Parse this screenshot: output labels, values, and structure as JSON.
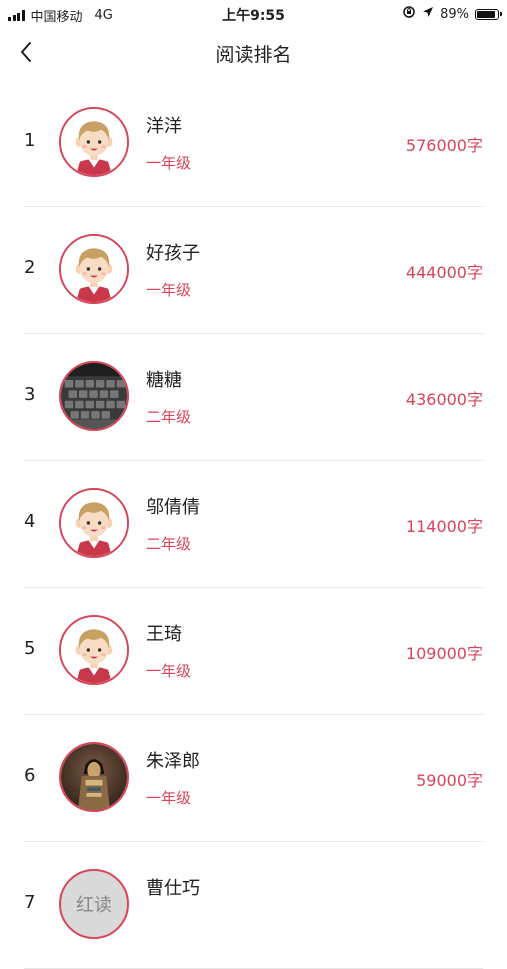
{
  "status_bar": {
    "carrier": "中国移动",
    "network": "4G",
    "time": "上午9:55",
    "battery": "89%",
    "battery_level": 0.89
  },
  "nav": {
    "title": "阅读排名",
    "back_icon": "chevron-left-icon"
  },
  "ranking": [
    {
      "rank": "1",
      "name": "洋洋",
      "grade": "一年级",
      "words": "576000字",
      "avatar": "cartoon-boy"
    },
    {
      "rank": "2",
      "name": "好孩子",
      "grade": "一年级",
      "words": "444000字",
      "avatar": "cartoon-boy"
    },
    {
      "rank": "3",
      "name": "糖糖",
      "grade": "二年级",
      "words": "436000字",
      "avatar": "keyboard-photo"
    },
    {
      "rank": "4",
      "name": "邬倩倩",
      "grade": "二年级",
      "words": "114000字",
      "avatar": "cartoon-boy"
    },
    {
      "rank": "5",
      "name": "王琦",
      "grade": "一年级",
      "words": "109000字",
      "avatar": "cartoon-boy"
    },
    {
      "rank": "6",
      "name": "朱泽郎",
      "grade": "一年级",
      "words": "59000字",
      "avatar": "statue-photo"
    },
    {
      "rank": "7",
      "name": "曹仕巧",
      "grade": "",
      "words": "",
      "avatar": "text-placeholder",
      "avatar_text": "红读"
    }
  ],
  "colors": {
    "accent": "#d8455a",
    "text": "#222222",
    "divider": "#e8e8e8"
  }
}
